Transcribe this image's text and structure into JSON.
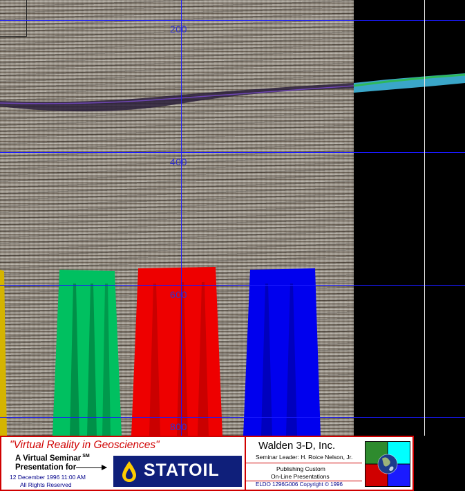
{
  "seismic": {
    "depth_labels": [
      "200",
      "400",
      "600",
      "800"
    ]
  },
  "banner": {
    "title": "\"Virtual Reality in Geosciences\"",
    "virtual_seminar": "A Virtual Seminar",
    "service_mark": "SM",
    "presentation_for": "Presentation for",
    "date": "12 December 1996  11:00 AM",
    "rights": "All Rights Reserved",
    "client_logo_text": "STATOIL",
    "company": "Walden 3-D, Inc.",
    "seminar_leader": "Seminar Leader: H. Roice Nelson, Jr.",
    "publishing_line1": "Publishing Custom",
    "publishing_line2": "On-Line Presentations",
    "copyright": "ELDO 1296G006 Copyright © 1996"
  },
  "colors": {
    "grid_line": "#1a1aff",
    "banner_border": "#d00000",
    "logo_blue": "#0f1f7a",
    "well_yellow": "#d4b400",
    "well_green": "#00c060",
    "well_red": "#ee0000",
    "well_blue": "#0000ee"
  }
}
